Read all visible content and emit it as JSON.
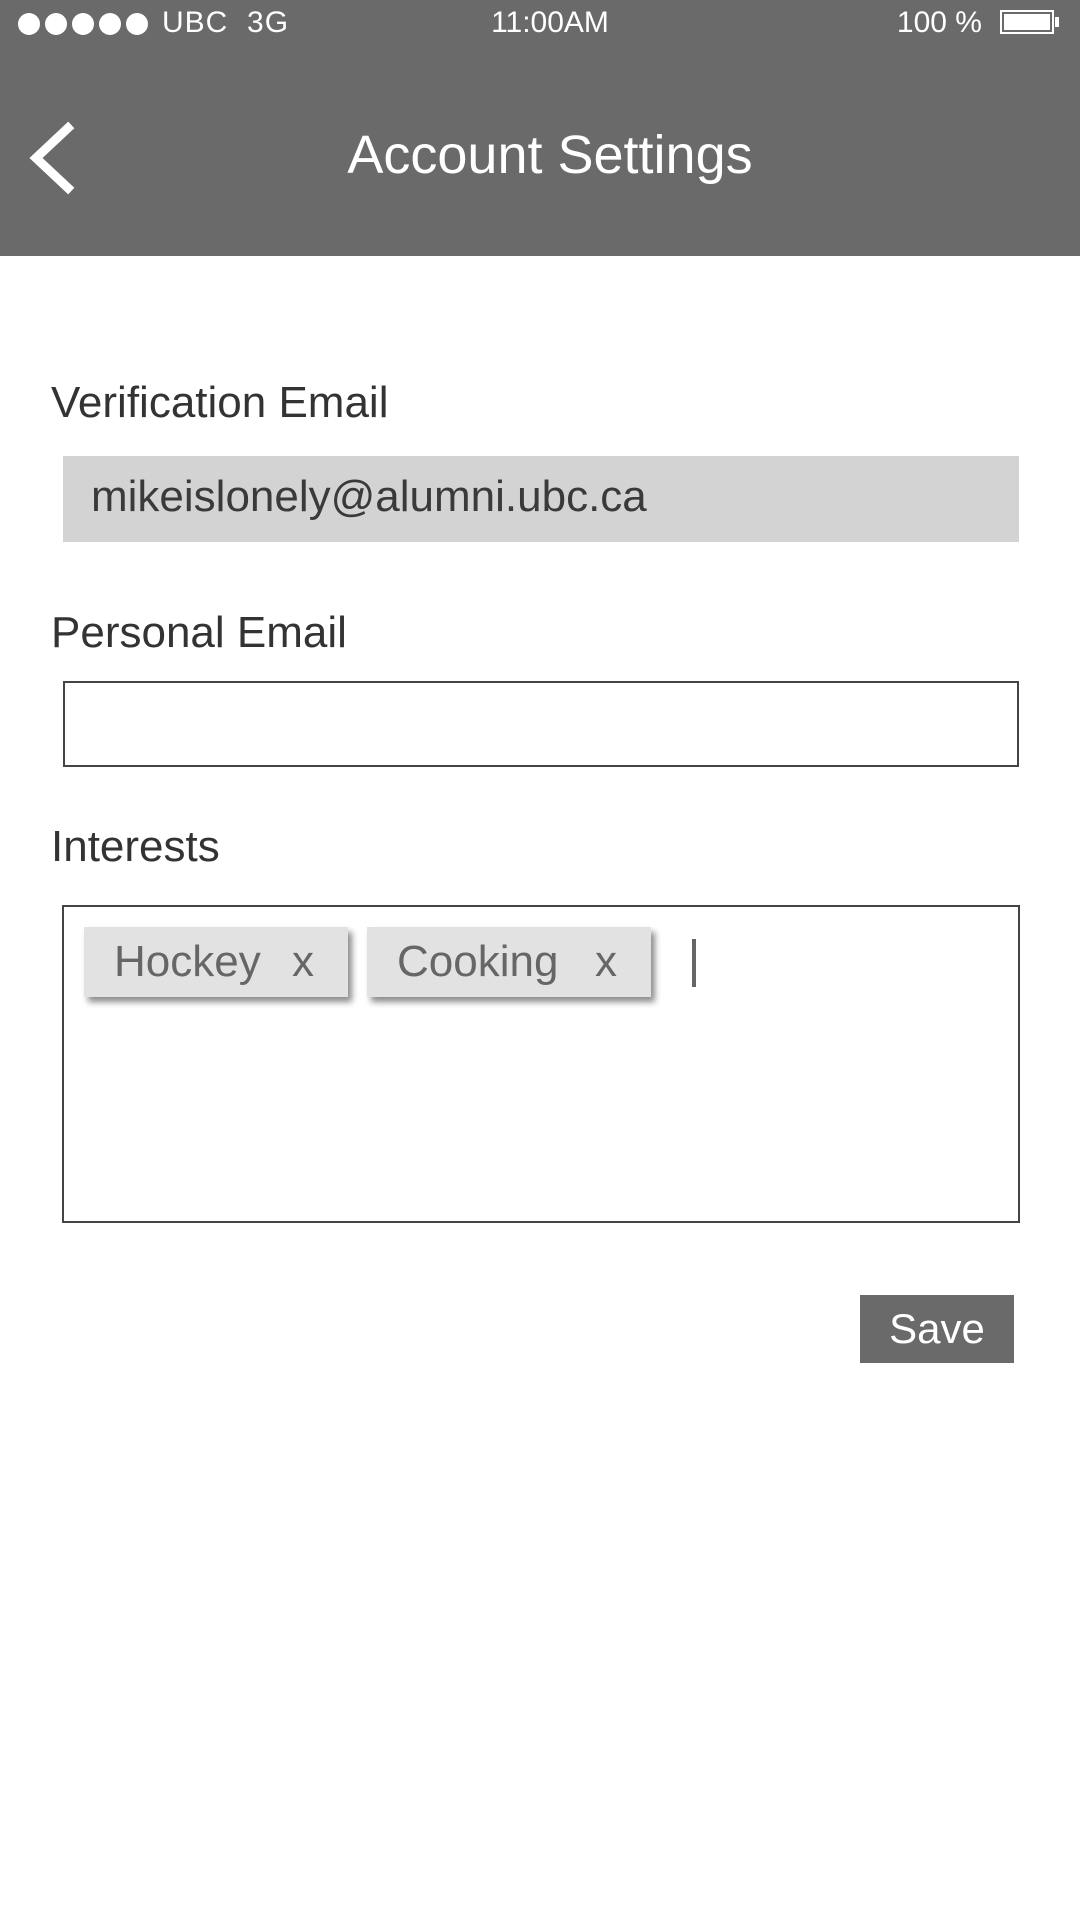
{
  "status_bar": {
    "carrier": "UBC  3G",
    "time": "11:00AM",
    "battery_percent": "100 %",
    "signal_bars": 5
  },
  "nav": {
    "title": "Account Settings",
    "back_icon": "chevron-left-icon"
  },
  "form": {
    "verification_email": {
      "label": "Verification Email",
      "value": "mikeislonely@alumni.ubc.ca"
    },
    "personal_email": {
      "label": "Personal Email",
      "value": "",
      "placeholder": ""
    },
    "interests": {
      "label": "Interests",
      "tags": [
        {
          "label": "Hockey",
          "remove": "x"
        },
        {
          "label": "Cooking",
          "remove": "x"
        }
      ]
    },
    "save_label": "Save"
  },
  "colors": {
    "header_bg": "#6a6a6a",
    "readonly_field_bg": "#d3d3d3",
    "tag_bg": "#e2e2e2",
    "button_bg": "#6a6a6a"
  }
}
